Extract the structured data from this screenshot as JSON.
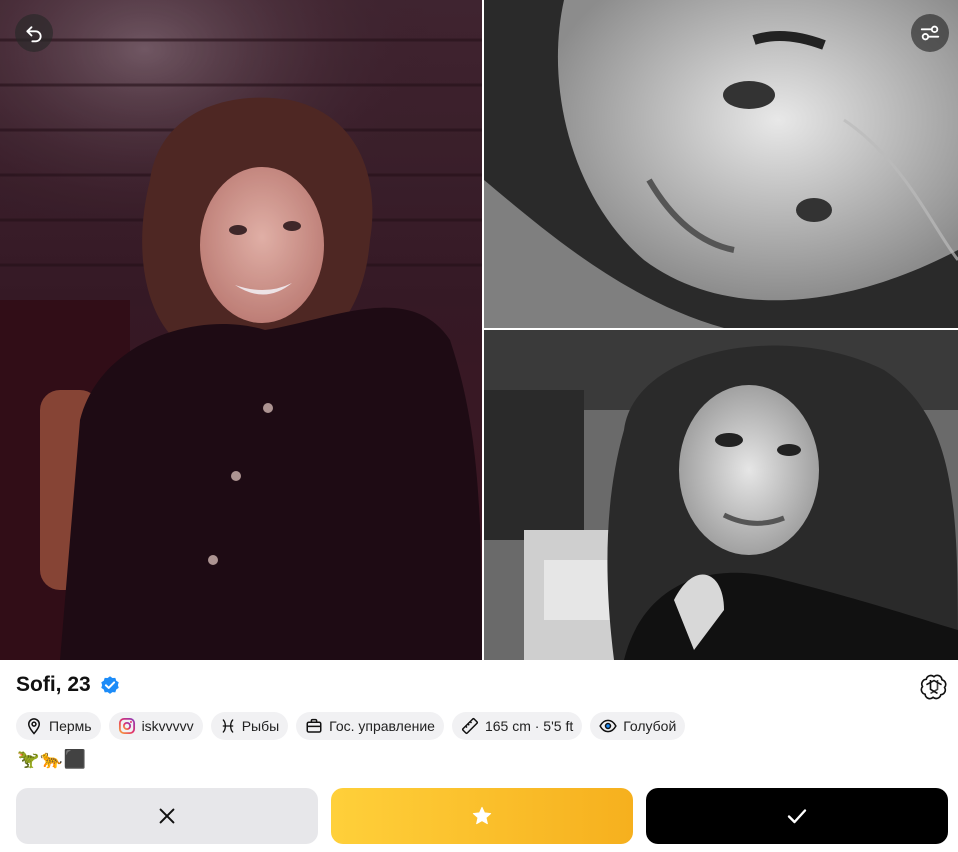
{
  "profile": {
    "name_age": "Sofi, 23",
    "verified": true
  },
  "chips": [
    {
      "icon": "location-pin-icon",
      "label": "Пермь"
    },
    {
      "icon": "instagram-icon",
      "label": "iskvvvvv"
    },
    {
      "icon": "pisces-icon",
      "label": "Рыбы"
    },
    {
      "icon": "briefcase-icon",
      "label": "Гос. управление"
    },
    {
      "icon": "ruler-icon",
      "label": "165 cm · 5'5 ft"
    },
    {
      "icon": "eye-icon",
      "label": "Голубой"
    }
  ],
  "emojis": "🦖🐆⬛",
  "photos": [
    {
      "name": "main-photo",
      "style": "color"
    },
    {
      "name": "top-right-photo",
      "style": "black-and-white"
    },
    {
      "name": "bottom-right-photo",
      "style": "black-and-white"
    }
  ],
  "actions": {
    "skip_icon": "close-icon",
    "super_icon": "star-icon",
    "like_icon": "check-icon"
  },
  "colors": {
    "verified": "#1d8cf8",
    "superlike_start": "#ffd03a",
    "superlike_end": "#f6b01e",
    "like": "#000000",
    "skip": "#e7e7ea",
    "chip": "#f1f1f3"
  }
}
